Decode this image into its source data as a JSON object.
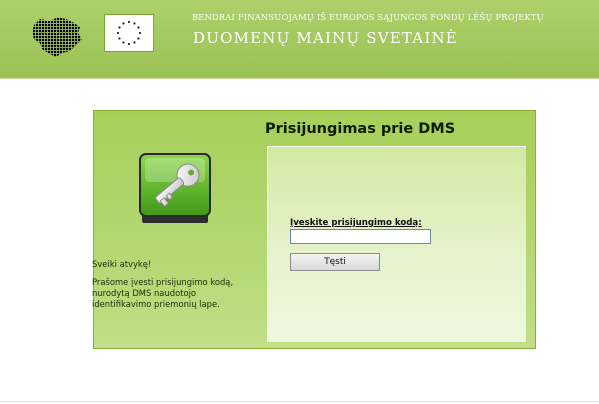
{
  "header": {
    "subtitle": "BENDRAI FINANSUOJAMŲ IŠ EUROPOS SĄJUNGOS FONDŲ LĖŠŲ PROJEKTŲ",
    "title": "DUOMENŲ MAINŲ SVETAINĖ",
    "logos": [
      "lithuania-map-icon",
      "eu-flag-icon"
    ]
  },
  "login": {
    "title": "Prisijungimas prie DMS",
    "welcome": "Sveiki atvykę!",
    "instructions": "Prašome įvesti prisijungimo kodą, nurodytą DMS naudotojo identifikavimo priemonių lape.",
    "code_label": "Įveskite prisijungimo kodą:",
    "code_value": "",
    "submit_label": "Tęsti",
    "icon": "key-icon"
  },
  "colors": {
    "header_green": "#9ac254",
    "panel_green": "#a7cf58",
    "form_background": "#e7f4cf",
    "header_text": "#ffffff"
  }
}
